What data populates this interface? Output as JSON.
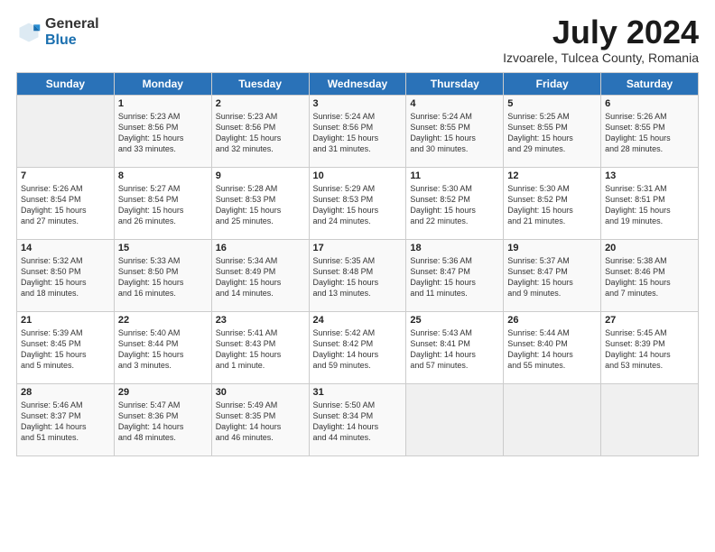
{
  "logo": {
    "general": "General",
    "blue": "Blue"
  },
  "title": "July 2024",
  "location": "Izvoarele, Tulcea County, Romania",
  "days_of_week": [
    "Sunday",
    "Monday",
    "Tuesday",
    "Wednesday",
    "Thursday",
    "Friday",
    "Saturday"
  ],
  "weeks": [
    [
      {
        "day": "",
        "info": ""
      },
      {
        "day": "1",
        "info": "Sunrise: 5:23 AM\nSunset: 8:56 PM\nDaylight: 15 hours\nand 33 minutes."
      },
      {
        "day": "2",
        "info": "Sunrise: 5:23 AM\nSunset: 8:56 PM\nDaylight: 15 hours\nand 32 minutes."
      },
      {
        "day": "3",
        "info": "Sunrise: 5:24 AM\nSunset: 8:56 PM\nDaylight: 15 hours\nand 31 minutes."
      },
      {
        "day": "4",
        "info": "Sunrise: 5:24 AM\nSunset: 8:55 PM\nDaylight: 15 hours\nand 30 minutes."
      },
      {
        "day": "5",
        "info": "Sunrise: 5:25 AM\nSunset: 8:55 PM\nDaylight: 15 hours\nand 29 minutes."
      },
      {
        "day": "6",
        "info": "Sunrise: 5:26 AM\nSunset: 8:55 PM\nDaylight: 15 hours\nand 28 minutes."
      }
    ],
    [
      {
        "day": "7",
        "info": "Sunrise: 5:26 AM\nSunset: 8:54 PM\nDaylight: 15 hours\nand 27 minutes."
      },
      {
        "day": "8",
        "info": "Sunrise: 5:27 AM\nSunset: 8:54 PM\nDaylight: 15 hours\nand 26 minutes."
      },
      {
        "day": "9",
        "info": "Sunrise: 5:28 AM\nSunset: 8:53 PM\nDaylight: 15 hours\nand 25 minutes."
      },
      {
        "day": "10",
        "info": "Sunrise: 5:29 AM\nSunset: 8:53 PM\nDaylight: 15 hours\nand 24 minutes."
      },
      {
        "day": "11",
        "info": "Sunrise: 5:30 AM\nSunset: 8:52 PM\nDaylight: 15 hours\nand 22 minutes."
      },
      {
        "day": "12",
        "info": "Sunrise: 5:30 AM\nSunset: 8:52 PM\nDaylight: 15 hours\nand 21 minutes."
      },
      {
        "day": "13",
        "info": "Sunrise: 5:31 AM\nSunset: 8:51 PM\nDaylight: 15 hours\nand 19 minutes."
      }
    ],
    [
      {
        "day": "14",
        "info": "Sunrise: 5:32 AM\nSunset: 8:50 PM\nDaylight: 15 hours\nand 18 minutes."
      },
      {
        "day": "15",
        "info": "Sunrise: 5:33 AM\nSunset: 8:50 PM\nDaylight: 15 hours\nand 16 minutes."
      },
      {
        "day": "16",
        "info": "Sunrise: 5:34 AM\nSunset: 8:49 PM\nDaylight: 15 hours\nand 14 minutes."
      },
      {
        "day": "17",
        "info": "Sunrise: 5:35 AM\nSunset: 8:48 PM\nDaylight: 15 hours\nand 13 minutes."
      },
      {
        "day": "18",
        "info": "Sunrise: 5:36 AM\nSunset: 8:47 PM\nDaylight: 15 hours\nand 11 minutes."
      },
      {
        "day": "19",
        "info": "Sunrise: 5:37 AM\nSunset: 8:47 PM\nDaylight: 15 hours\nand 9 minutes."
      },
      {
        "day": "20",
        "info": "Sunrise: 5:38 AM\nSunset: 8:46 PM\nDaylight: 15 hours\nand 7 minutes."
      }
    ],
    [
      {
        "day": "21",
        "info": "Sunrise: 5:39 AM\nSunset: 8:45 PM\nDaylight: 15 hours\nand 5 minutes."
      },
      {
        "day": "22",
        "info": "Sunrise: 5:40 AM\nSunset: 8:44 PM\nDaylight: 15 hours\nand 3 minutes."
      },
      {
        "day": "23",
        "info": "Sunrise: 5:41 AM\nSunset: 8:43 PM\nDaylight: 15 hours\nand 1 minute."
      },
      {
        "day": "24",
        "info": "Sunrise: 5:42 AM\nSunset: 8:42 PM\nDaylight: 14 hours\nand 59 minutes."
      },
      {
        "day": "25",
        "info": "Sunrise: 5:43 AM\nSunset: 8:41 PM\nDaylight: 14 hours\nand 57 minutes."
      },
      {
        "day": "26",
        "info": "Sunrise: 5:44 AM\nSunset: 8:40 PM\nDaylight: 14 hours\nand 55 minutes."
      },
      {
        "day": "27",
        "info": "Sunrise: 5:45 AM\nSunset: 8:39 PM\nDaylight: 14 hours\nand 53 minutes."
      }
    ],
    [
      {
        "day": "28",
        "info": "Sunrise: 5:46 AM\nSunset: 8:37 PM\nDaylight: 14 hours\nand 51 minutes."
      },
      {
        "day": "29",
        "info": "Sunrise: 5:47 AM\nSunset: 8:36 PM\nDaylight: 14 hours\nand 48 minutes."
      },
      {
        "day": "30",
        "info": "Sunrise: 5:49 AM\nSunset: 8:35 PM\nDaylight: 14 hours\nand 46 minutes."
      },
      {
        "day": "31",
        "info": "Sunrise: 5:50 AM\nSunset: 8:34 PM\nDaylight: 14 hours\nand 44 minutes."
      },
      {
        "day": "",
        "info": ""
      },
      {
        "day": "",
        "info": ""
      },
      {
        "day": "",
        "info": ""
      }
    ]
  ]
}
